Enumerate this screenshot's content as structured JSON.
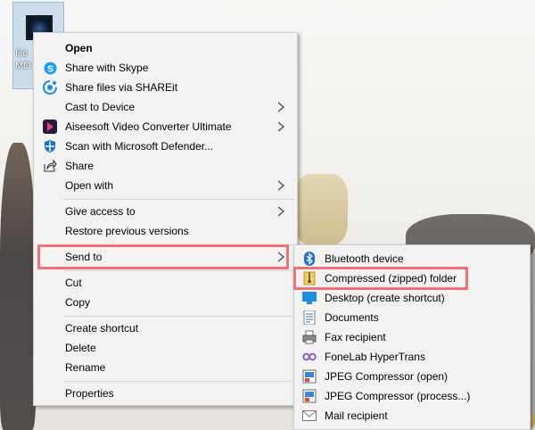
{
  "desktop": {
    "icon_label_line1": "file",
    "icon_label_line2": "MO"
  },
  "context_menu": {
    "items": [
      {
        "label": "Open",
        "icon": "none",
        "bold": true
      },
      {
        "label": "Share with Skype",
        "icon": "skype-icon"
      },
      {
        "label": "Share files via SHAREit",
        "icon": "shareit-icon"
      },
      {
        "label": "Cast to Device",
        "icon": "none",
        "submenu": true
      },
      {
        "label": "Aiseesoft Video Converter Ultimate",
        "icon": "aiseesoft-icon",
        "submenu": true
      },
      {
        "label": "Scan with Microsoft Defender...",
        "icon": "defender-icon"
      },
      {
        "label": "Share",
        "icon": "share-icon"
      },
      {
        "label": "Open with",
        "icon": "none",
        "submenu": true
      },
      {
        "label": "Give access to",
        "icon": "none",
        "submenu": true
      },
      {
        "label": "Restore previous versions",
        "icon": "none"
      },
      {
        "label": "Send to",
        "icon": "none",
        "submenu": true,
        "highlighted": true
      },
      {
        "label": "Cut",
        "icon": "none"
      },
      {
        "label": "Copy",
        "icon": "none"
      },
      {
        "label": "Create shortcut",
        "icon": "none"
      },
      {
        "label": "Delete",
        "icon": "none"
      },
      {
        "label": "Rename",
        "icon": "none"
      },
      {
        "label": "Properties",
        "icon": "none"
      }
    ]
  },
  "send_to_menu": {
    "items": [
      {
        "label": "Bluetooth device",
        "icon": "bluetooth-icon"
      },
      {
        "label": "Compressed (zipped) folder",
        "icon": "zip-folder-icon",
        "highlighted": true
      },
      {
        "label": "Desktop (create shortcut)",
        "icon": "desktop-icon"
      },
      {
        "label": "Documents",
        "icon": "documents-icon"
      },
      {
        "label": "Fax recipient",
        "icon": "fax-icon"
      },
      {
        "label": "FoneLab HyperTrans",
        "icon": "hypertrans-icon"
      },
      {
        "label": "JPEG Compressor (open)",
        "icon": "jpeg-compressor-icon"
      },
      {
        "label": "JPEG Compressor (process...)",
        "icon": "jpeg-compressor-icon"
      },
      {
        "label": "Mail recipient",
        "icon": "mail-icon"
      }
    ]
  },
  "colors": {
    "highlight_border": "#f07078",
    "menu_bg": "#f2f2f2",
    "accent_blue": "#1e73c8"
  }
}
